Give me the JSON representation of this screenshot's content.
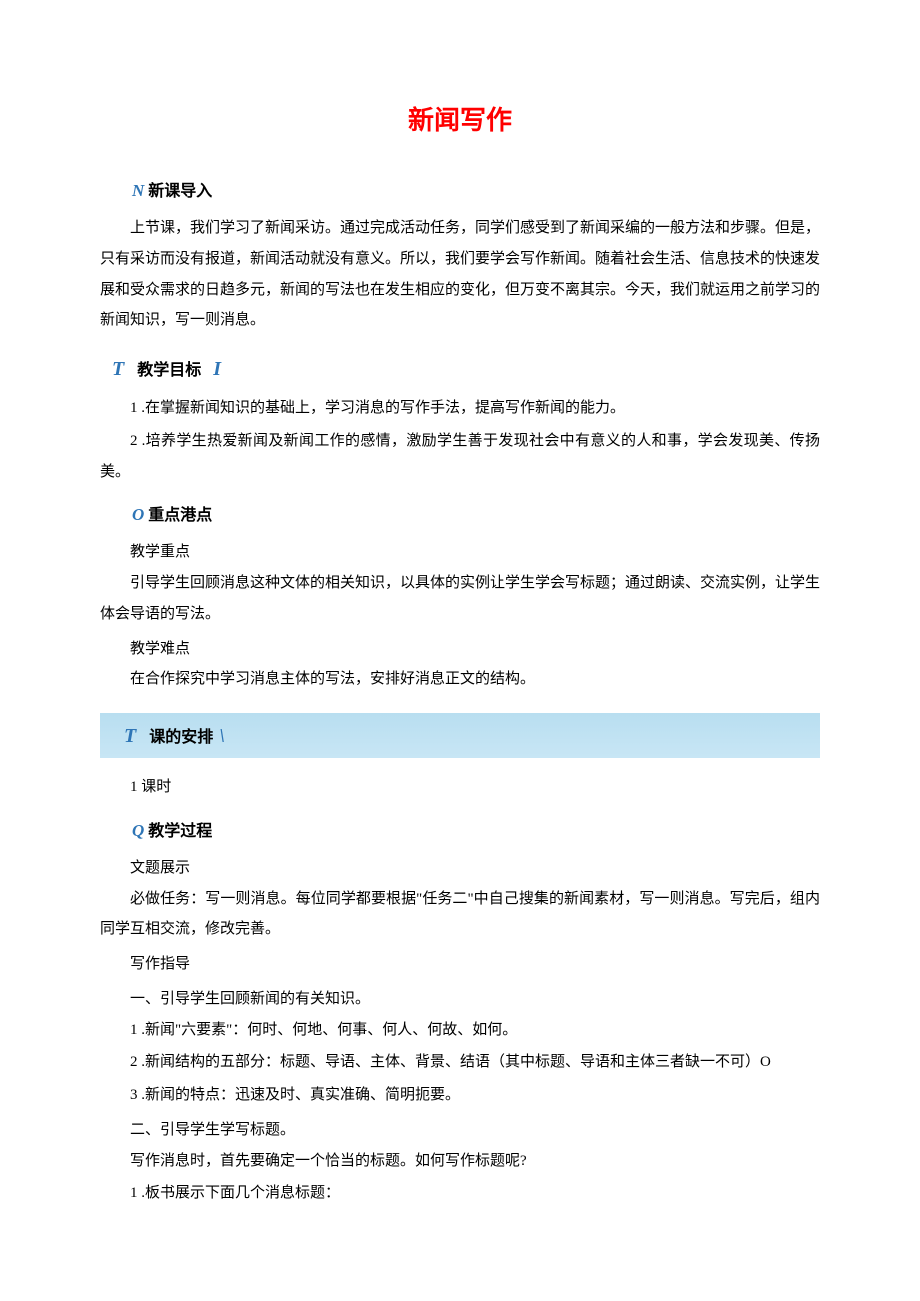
{
  "title": "新闻写作",
  "sections": {
    "intro": {
      "prefix": "N",
      "heading": "新课导入",
      "para1": "上节课，我们学习了新闻采访。通过完成活动任务，同学们感受到了新闻采编的一般方法和步骤。但是，只有采访而没有报道，新闻活动就没有意义。所以，我们要学会写作新闻。随着社会生活、信息技术的快速发展和受众需求的日趋多元，新闻的写法也在发生相应的变化，但万变不离其宗。今天，我们就运用之前学习的新闻知识，写一则消息。"
    },
    "target": {
      "prefix": "T",
      "heading": "教学目标",
      "suffix": "I",
      "item1": "1 .在掌握新闻知识的基础上，学习消息的写作手法，提高写作新闻的能力。",
      "item2": "2 .培养学生热爱新闻及新闻工作的感情，激励学生善于发现社会中有意义的人和事，学会发现美、传扬美。"
    },
    "key": {
      "prefix": "O",
      "heading": "重点港点",
      "sub1_title": "教学重点",
      "sub1_text": "引导学生回顾消息这种文体的相关知识，以具体的实例让学生学会写标题；通过朗读、交流实例，让学生体会导语的写法。",
      "sub2_title": "教学难点",
      "sub2_text": "在合作探究中学习消息主体的写法，安排好消息正文的结构。"
    },
    "schedule": {
      "prefix": "T",
      "heading": "课的安排",
      "suffix": "\\",
      "text": "1 课时"
    },
    "process": {
      "prefix": "Q",
      "heading": "教学过程",
      "sub1": "文题展示",
      "sub1_text": "必做任务：写一则消息。每位同学都要根据\"任务二\"中自己搜集的新闻素材，写一则消息。写完后，组内同学互相交流，修改完善。",
      "sub2": "写作指导",
      "sec1_title": "一、引导学生回顾新闻的有关知识。",
      "sec1_item1": "1 .新闻\"六要素\"：何时、何地、何事、何人、何故、如何。",
      "sec1_item2": "2 .新闻结构的五部分：标题、导语、主体、背景、结语（其中标题、导语和主体三者缺一不可）O",
      "sec1_item3": "3 .新闻的特点：迅速及时、真实准确、简明扼要。",
      "sec2_title": "二、引导学生学写标题。",
      "sec2_text1": "写作消息时，首先要确定一个恰当的标题。如何写作标题呢?",
      "sec2_item1": "1 .板书展示下面几个消息标题："
    }
  }
}
